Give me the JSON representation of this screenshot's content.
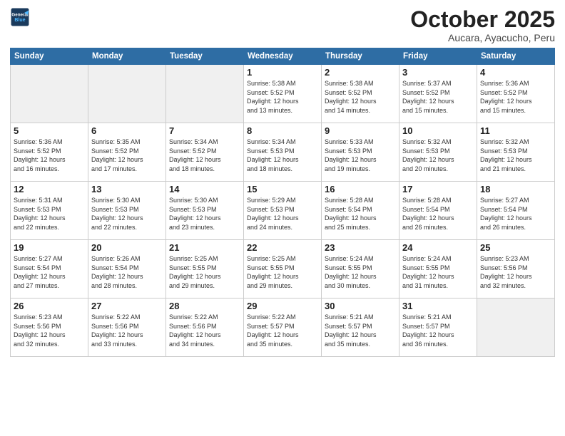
{
  "header": {
    "logo_line1": "General",
    "logo_line2": "Blue",
    "month": "October 2025",
    "location": "Aucara, Ayacucho, Peru"
  },
  "weekdays": [
    "Sunday",
    "Monday",
    "Tuesday",
    "Wednesday",
    "Thursday",
    "Friday",
    "Saturday"
  ],
  "weeks": [
    [
      {
        "day": "",
        "info": ""
      },
      {
        "day": "",
        "info": ""
      },
      {
        "day": "",
        "info": ""
      },
      {
        "day": "1",
        "info": "Sunrise: 5:38 AM\nSunset: 5:52 PM\nDaylight: 12 hours\nand 13 minutes."
      },
      {
        "day": "2",
        "info": "Sunrise: 5:38 AM\nSunset: 5:52 PM\nDaylight: 12 hours\nand 14 minutes."
      },
      {
        "day": "3",
        "info": "Sunrise: 5:37 AM\nSunset: 5:52 PM\nDaylight: 12 hours\nand 15 minutes."
      },
      {
        "day": "4",
        "info": "Sunrise: 5:36 AM\nSunset: 5:52 PM\nDaylight: 12 hours\nand 15 minutes."
      }
    ],
    [
      {
        "day": "5",
        "info": "Sunrise: 5:36 AM\nSunset: 5:52 PM\nDaylight: 12 hours\nand 16 minutes."
      },
      {
        "day": "6",
        "info": "Sunrise: 5:35 AM\nSunset: 5:52 PM\nDaylight: 12 hours\nand 17 minutes."
      },
      {
        "day": "7",
        "info": "Sunrise: 5:34 AM\nSunset: 5:52 PM\nDaylight: 12 hours\nand 18 minutes."
      },
      {
        "day": "8",
        "info": "Sunrise: 5:34 AM\nSunset: 5:53 PM\nDaylight: 12 hours\nand 18 minutes."
      },
      {
        "day": "9",
        "info": "Sunrise: 5:33 AM\nSunset: 5:53 PM\nDaylight: 12 hours\nand 19 minutes."
      },
      {
        "day": "10",
        "info": "Sunrise: 5:32 AM\nSunset: 5:53 PM\nDaylight: 12 hours\nand 20 minutes."
      },
      {
        "day": "11",
        "info": "Sunrise: 5:32 AM\nSunset: 5:53 PM\nDaylight: 12 hours\nand 21 minutes."
      }
    ],
    [
      {
        "day": "12",
        "info": "Sunrise: 5:31 AM\nSunset: 5:53 PM\nDaylight: 12 hours\nand 22 minutes."
      },
      {
        "day": "13",
        "info": "Sunrise: 5:30 AM\nSunset: 5:53 PM\nDaylight: 12 hours\nand 22 minutes."
      },
      {
        "day": "14",
        "info": "Sunrise: 5:30 AM\nSunset: 5:53 PM\nDaylight: 12 hours\nand 23 minutes."
      },
      {
        "day": "15",
        "info": "Sunrise: 5:29 AM\nSunset: 5:53 PM\nDaylight: 12 hours\nand 24 minutes."
      },
      {
        "day": "16",
        "info": "Sunrise: 5:28 AM\nSunset: 5:54 PM\nDaylight: 12 hours\nand 25 minutes."
      },
      {
        "day": "17",
        "info": "Sunrise: 5:28 AM\nSunset: 5:54 PM\nDaylight: 12 hours\nand 26 minutes."
      },
      {
        "day": "18",
        "info": "Sunrise: 5:27 AM\nSunset: 5:54 PM\nDaylight: 12 hours\nand 26 minutes."
      }
    ],
    [
      {
        "day": "19",
        "info": "Sunrise: 5:27 AM\nSunset: 5:54 PM\nDaylight: 12 hours\nand 27 minutes."
      },
      {
        "day": "20",
        "info": "Sunrise: 5:26 AM\nSunset: 5:54 PM\nDaylight: 12 hours\nand 28 minutes."
      },
      {
        "day": "21",
        "info": "Sunrise: 5:25 AM\nSunset: 5:55 PM\nDaylight: 12 hours\nand 29 minutes."
      },
      {
        "day": "22",
        "info": "Sunrise: 5:25 AM\nSunset: 5:55 PM\nDaylight: 12 hours\nand 29 minutes."
      },
      {
        "day": "23",
        "info": "Sunrise: 5:24 AM\nSunset: 5:55 PM\nDaylight: 12 hours\nand 30 minutes."
      },
      {
        "day": "24",
        "info": "Sunrise: 5:24 AM\nSunset: 5:55 PM\nDaylight: 12 hours\nand 31 minutes."
      },
      {
        "day": "25",
        "info": "Sunrise: 5:23 AM\nSunset: 5:56 PM\nDaylight: 12 hours\nand 32 minutes."
      }
    ],
    [
      {
        "day": "26",
        "info": "Sunrise: 5:23 AM\nSunset: 5:56 PM\nDaylight: 12 hours\nand 32 minutes."
      },
      {
        "day": "27",
        "info": "Sunrise: 5:22 AM\nSunset: 5:56 PM\nDaylight: 12 hours\nand 33 minutes."
      },
      {
        "day": "28",
        "info": "Sunrise: 5:22 AM\nSunset: 5:56 PM\nDaylight: 12 hours\nand 34 minutes."
      },
      {
        "day": "29",
        "info": "Sunrise: 5:22 AM\nSunset: 5:57 PM\nDaylight: 12 hours\nand 35 minutes."
      },
      {
        "day": "30",
        "info": "Sunrise: 5:21 AM\nSunset: 5:57 PM\nDaylight: 12 hours\nand 35 minutes."
      },
      {
        "day": "31",
        "info": "Sunrise: 5:21 AM\nSunset: 5:57 PM\nDaylight: 12 hours\nand 36 minutes."
      },
      {
        "day": "",
        "info": ""
      }
    ]
  ]
}
